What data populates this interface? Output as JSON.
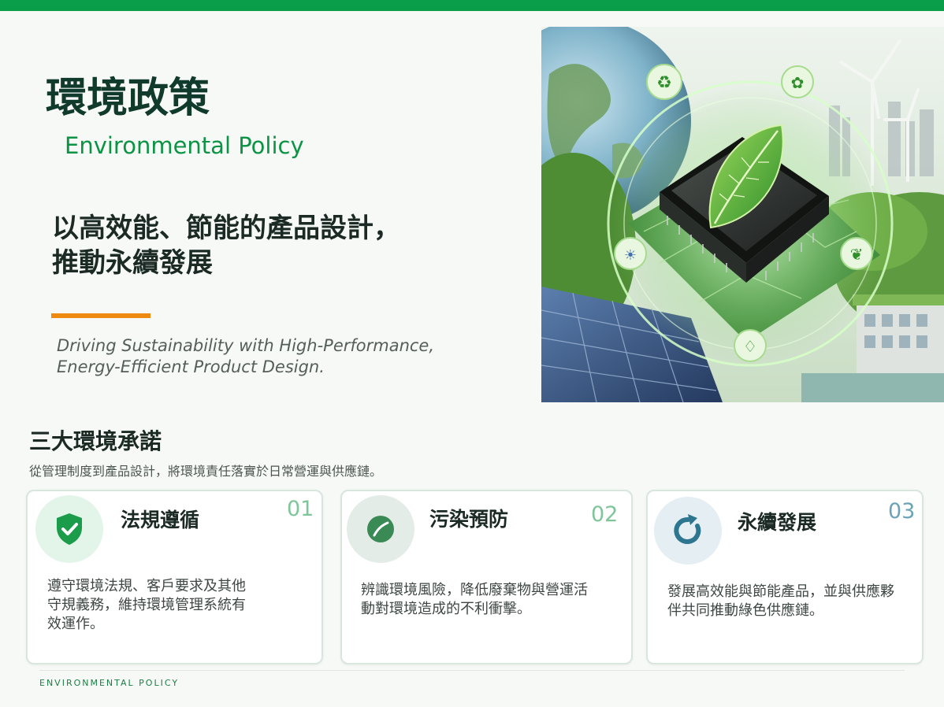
{
  "header": {
    "title_zh": "環境政策",
    "title_en": "Environmental Policy",
    "slogan_lines": [
      "以高效能、節能的產品設計，",
      "推動永續發展"
    ],
    "subtitle_en_lines": [
      "Driving Sustainability with High-Performance,",
      "Energy-Efficient Product Design."
    ]
  },
  "section": {
    "title": "三大環境承諾",
    "description": "從管理制度到產品設計，將環境責任落實於日常營運與供應鏈。"
  },
  "cards": [
    {
      "number": "01",
      "title": "法規遵循",
      "icon": "shield-check-icon",
      "text_lines": [
        "遵守環境法規、客戶要求及其他",
        "守規義務，維持環境管理系統有",
        "效運作。"
      ]
    },
    {
      "number": "02",
      "title": "污染預防",
      "icon": "leaf-icon",
      "text_lines": [
        "辨識環境風險，降低廢棄物與營運活",
        "動對環境造成的不利衝擊。"
      ]
    },
    {
      "number": "03",
      "title": "永續發展",
      "icon": "cycle-arrow-icon",
      "text_lines": [
        "發展高效能與節能產品，並與供應夥",
        "伴共同推動綠色供應鏈。"
      ]
    }
  ],
  "footer": {
    "label": "ENVIRONMENTAL POLICY"
  },
  "colors": {
    "brand_green": "#0a9d4a",
    "accent_orange": "#ee8a10",
    "title_dark_green": "#0f3a2c",
    "number_green": "#7fc59a",
    "number_teal": "#6aa3b8"
  }
}
